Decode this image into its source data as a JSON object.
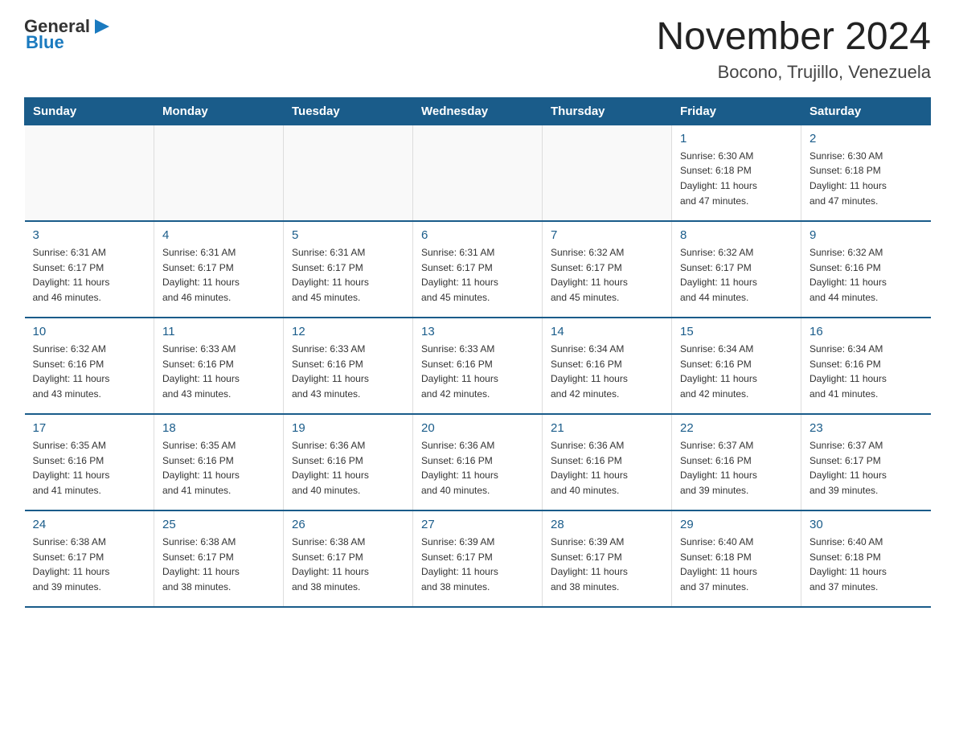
{
  "header": {
    "logo": {
      "general": "General",
      "arrow_icon": "▶",
      "blue": "Blue"
    },
    "title": "November 2024",
    "subtitle": "Bocono, Trujillo, Venezuela"
  },
  "calendar": {
    "weekdays": [
      "Sunday",
      "Monday",
      "Tuesday",
      "Wednesday",
      "Thursday",
      "Friday",
      "Saturday"
    ],
    "weeks": [
      [
        {
          "day": "",
          "info": ""
        },
        {
          "day": "",
          "info": ""
        },
        {
          "day": "",
          "info": ""
        },
        {
          "day": "",
          "info": ""
        },
        {
          "day": "",
          "info": ""
        },
        {
          "day": "1",
          "info": "Sunrise: 6:30 AM\nSunset: 6:18 PM\nDaylight: 11 hours\nand 47 minutes."
        },
        {
          "day": "2",
          "info": "Sunrise: 6:30 AM\nSunset: 6:18 PM\nDaylight: 11 hours\nand 47 minutes."
        }
      ],
      [
        {
          "day": "3",
          "info": "Sunrise: 6:31 AM\nSunset: 6:17 PM\nDaylight: 11 hours\nand 46 minutes."
        },
        {
          "day": "4",
          "info": "Sunrise: 6:31 AM\nSunset: 6:17 PM\nDaylight: 11 hours\nand 46 minutes."
        },
        {
          "day": "5",
          "info": "Sunrise: 6:31 AM\nSunset: 6:17 PM\nDaylight: 11 hours\nand 45 minutes."
        },
        {
          "day": "6",
          "info": "Sunrise: 6:31 AM\nSunset: 6:17 PM\nDaylight: 11 hours\nand 45 minutes."
        },
        {
          "day": "7",
          "info": "Sunrise: 6:32 AM\nSunset: 6:17 PM\nDaylight: 11 hours\nand 45 minutes."
        },
        {
          "day": "8",
          "info": "Sunrise: 6:32 AM\nSunset: 6:17 PM\nDaylight: 11 hours\nand 44 minutes."
        },
        {
          "day": "9",
          "info": "Sunrise: 6:32 AM\nSunset: 6:16 PM\nDaylight: 11 hours\nand 44 minutes."
        }
      ],
      [
        {
          "day": "10",
          "info": "Sunrise: 6:32 AM\nSunset: 6:16 PM\nDaylight: 11 hours\nand 43 minutes."
        },
        {
          "day": "11",
          "info": "Sunrise: 6:33 AM\nSunset: 6:16 PM\nDaylight: 11 hours\nand 43 minutes."
        },
        {
          "day": "12",
          "info": "Sunrise: 6:33 AM\nSunset: 6:16 PM\nDaylight: 11 hours\nand 43 minutes."
        },
        {
          "day": "13",
          "info": "Sunrise: 6:33 AM\nSunset: 6:16 PM\nDaylight: 11 hours\nand 42 minutes."
        },
        {
          "day": "14",
          "info": "Sunrise: 6:34 AM\nSunset: 6:16 PM\nDaylight: 11 hours\nand 42 minutes."
        },
        {
          "day": "15",
          "info": "Sunrise: 6:34 AM\nSunset: 6:16 PM\nDaylight: 11 hours\nand 42 minutes."
        },
        {
          "day": "16",
          "info": "Sunrise: 6:34 AM\nSunset: 6:16 PM\nDaylight: 11 hours\nand 41 minutes."
        }
      ],
      [
        {
          "day": "17",
          "info": "Sunrise: 6:35 AM\nSunset: 6:16 PM\nDaylight: 11 hours\nand 41 minutes."
        },
        {
          "day": "18",
          "info": "Sunrise: 6:35 AM\nSunset: 6:16 PM\nDaylight: 11 hours\nand 41 minutes."
        },
        {
          "day": "19",
          "info": "Sunrise: 6:36 AM\nSunset: 6:16 PM\nDaylight: 11 hours\nand 40 minutes."
        },
        {
          "day": "20",
          "info": "Sunrise: 6:36 AM\nSunset: 6:16 PM\nDaylight: 11 hours\nand 40 minutes."
        },
        {
          "day": "21",
          "info": "Sunrise: 6:36 AM\nSunset: 6:16 PM\nDaylight: 11 hours\nand 40 minutes."
        },
        {
          "day": "22",
          "info": "Sunrise: 6:37 AM\nSunset: 6:16 PM\nDaylight: 11 hours\nand 39 minutes."
        },
        {
          "day": "23",
          "info": "Sunrise: 6:37 AM\nSunset: 6:17 PM\nDaylight: 11 hours\nand 39 minutes."
        }
      ],
      [
        {
          "day": "24",
          "info": "Sunrise: 6:38 AM\nSunset: 6:17 PM\nDaylight: 11 hours\nand 39 minutes."
        },
        {
          "day": "25",
          "info": "Sunrise: 6:38 AM\nSunset: 6:17 PM\nDaylight: 11 hours\nand 38 minutes."
        },
        {
          "day": "26",
          "info": "Sunrise: 6:38 AM\nSunset: 6:17 PM\nDaylight: 11 hours\nand 38 minutes."
        },
        {
          "day": "27",
          "info": "Sunrise: 6:39 AM\nSunset: 6:17 PM\nDaylight: 11 hours\nand 38 minutes."
        },
        {
          "day": "28",
          "info": "Sunrise: 6:39 AM\nSunset: 6:17 PM\nDaylight: 11 hours\nand 38 minutes."
        },
        {
          "day": "29",
          "info": "Sunrise: 6:40 AM\nSunset: 6:18 PM\nDaylight: 11 hours\nand 37 minutes."
        },
        {
          "day": "30",
          "info": "Sunrise: 6:40 AM\nSunset: 6:18 PM\nDaylight: 11 hours\nand 37 minutes."
        }
      ]
    ]
  }
}
